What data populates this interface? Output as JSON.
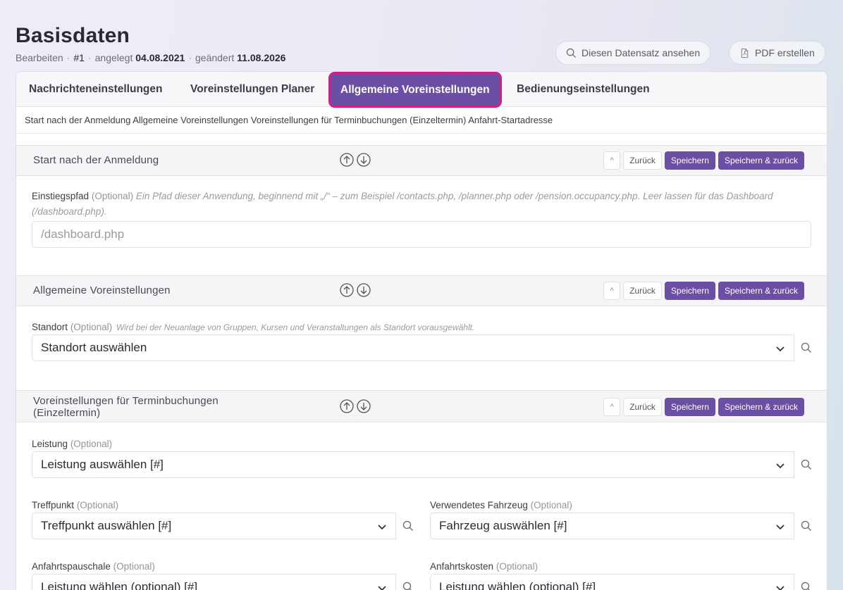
{
  "header": {
    "title": "Basisdaten",
    "edit_label": "Bearbeiten",
    "record_id": "#1",
    "created_label": "angelegt",
    "created_date": "04.08.2021",
    "changed_label": "geändert",
    "changed_date": "11.08.2026",
    "view_button": "Diesen Datensatz ansehen",
    "pdf_button": "PDF erstellen"
  },
  "tabs": [
    {
      "label": "Nachrichteneinstellungen",
      "active": false
    },
    {
      "label": "Voreinstellungen Planer",
      "active": false
    },
    {
      "label": "Allgemeine Voreinstellungen",
      "active": true
    },
    {
      "label": "Bedienungseinstellungen",
      "active": false
    }
  ],
  "breadcrumb": "Start nach der Anmeldung Allgemeine Voreinstellungen Voreinstellungen für Terminbuchungen (Einzeltermin) Anfahrt-Startadresse",
  "section_buttons": {
    "collapse": "^",
    "back": "Zurück",
    "save": "Speichern",
    "save_back": "Speichern & zurück"
  },
  "sections": {
    "start": {
      "title": "Start nach der Anmeldung",
      "entry_label": "Einstiegspfad",
      "entry_optional": "(Optional)",
      "entry_hint": "Ein Pfad dieser Anwendung, beginnend mit „/“ – zum Beispiel /contacts.php, /planner.php oder /pension.occupancy.php. Leer lassen für das Dashboard (/dashboard.php).",
      "entry_placeholder": "/dashboard.php"
    },
    "general": {
      "title": "Allgemeine Voreinstellungen",
      "location_label": "Standort",
      "location_optional": "(Optional)",
      "location_hint": "Wird bei der Neuanlage von Gruppen, Kursen und Veranstaltungen als Standort vorausgewählt.",
      "location_value": "Standort auswählen"
    },
    "booking": {
      "title_line1": "Voreinstellungen für Terminbuchungen",
      "title_line2": "(Einzeltermin)",
      "service_label": "Leistung",
      "service_value": "Leistung auswählen [#]",
      "meeting_label": "Treffpunkt",
      "meeting_value": "Treffpunkt auswählen [#]",
      "vehicle_label": "Verwendetes Fahrzeug",
      "vehicle_value": "Fahrzeug auswählen [#]",
      "flat_fee_label": "Anfahrtspauschale",
      "flat_fee_value": "Leistung wählen (optional) [#]",
      "travel_cost_label": "Anfahrtskosten",
      "travel_cost_value": "Leistung wählen (optional) [#]",
      "optional": "(Optional)"
    }
  },
  "colors": {
    "accent": "#6a4fa5",
    "tab_highlight": "#d21d86"
  }
}
